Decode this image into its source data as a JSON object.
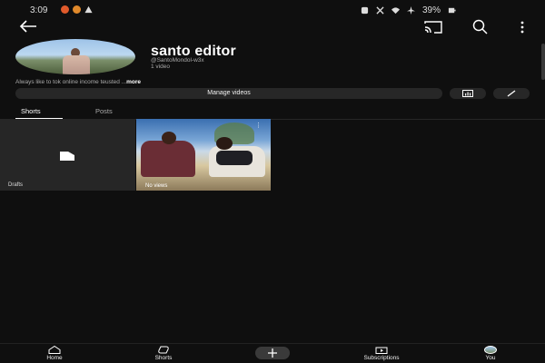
{
  "status_bar": {
    "time": "3:09",
    "battery": "39%",
    "dot_colors": [
      "#e05a2b",
      "#e0892b"
    ]
  },
  "toolbar": {
    "icons": [
      "back-arrow-icon",
      "cast-icon",
      "search-icon",
      "more-vert-icon"
    ]
  },
  "channel": {
    "name": "santo editor",
    "handle": "@SantoMondol-w3x",
    "video_count": "1 video",
    "description": "Always  like to tok online income  teusted ...",
    "description_more": "more"
  },
  "actions": {
    "manage_label": "Manage videos",
    "icons": [
      "analytics-icon",
      "edit-pencil-icon"
    ]
  },
  "tabs": [
    {
      "label": "Shorts",
      "active": true
    },
    {
      "label": "Posts",
      "active": false
    }
  ],
  "grid": {
    "drafts_label": "Drafts",
    "short_views": "No views",
    "short_more": "⋮"
  },
  "bottom_nav": [
    {
      "label": "Home",
      "icon": "home-icon"
    },
    {
      "label": "Shorts",
      "icon": "shorts-icon"
    },
    {
      "label": "",
      "icon": "create-plus-icon"
    },
    {
      "label": "Subscriptions",
      "icon": "subscriptions-icon"
    },
    {
      "label": "You",
      "icon": "you-avatar-icon"
    }
  ]
}
